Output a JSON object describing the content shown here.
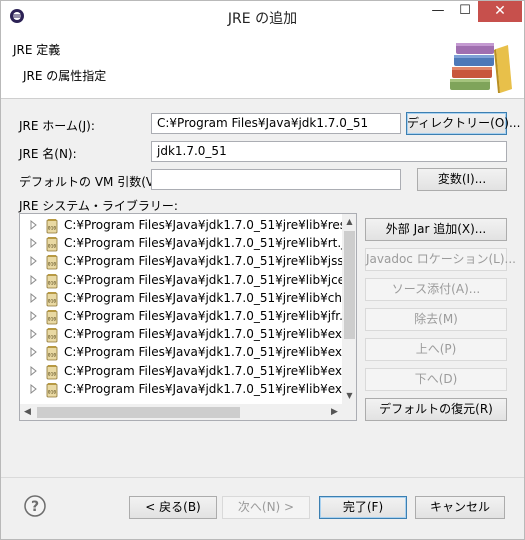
{
  "window": {
    "title": "JRE の追加",
    "close_glyph": "✕",
    "minimize_glyph": "—",
    "maximize_glyph": "☐"
  },
  "header": {
    "title": "JRE 定義",
    "description": "JRE の属性指定"
  },
  "form": {
    "jre_home_label": "JRE ホーム(J):",
    "jre_home_value": "C:¥Program Files¥Java¥jdk1.7.0_51",
    "directory_button": "ディレクトリー(O)...",
    "jre_name_label": "JRE 名(N):",
    "jre_name_value": "jdk1.7.0_51",
    "vm_args_label": "デフォルトの VM 引数(V):",
    "vm_args_value": "",
    "variables_button": "変数(I)...",
    "libraries_label": "JRE システム・ライブラリー:"
  },
  "libraries": [
    "C:¥Program Files¥Java¥jdk1.7.0_51¥jre¥lib¥res",
    "C:¥Program Files¥Java¥jdk1.7.0_51¥jre¥lib¥rt.j",
    "C:¥Program Files¥Java¥jdk1.7.0_51¥jre¥lib¥jsse",
    "C:¥Program Files¥Java¥jdk1.7.0_51¥jre¥lib¥jce",
    "C:¥Program Files¥Java¥jdk1.7.0_51¥jre¥lib¥cha",
    "C:¥Program Files¥Java¥jdk1.7.0_51¥jre¥lib¥jfr.j",
    "C:¥Program Files¥Java¥jdk1.7.0_51¥jre¥lib¥ext",
    "C:¥Program Files¥Java¥jdk1.7.0_51¥jre¥lib¥ext",
    "C:¥Program Files¥Java¥jdk1.7.0_51¥jre¥lib¥ext",
    "C:¥Program Files¥Java¥jdk1.7.0_51¥jre¥lib¥ext"
  ],
  "library_buttons": {
    "add_external_jar": "外部 Jar 追加(X)...",
    "javadoc_location": "Javadoc ロケーション(L)...",
    "source_attachment": "ソース添付(A)...",
    "remove": "除去(M)",
    "up": "上へ(P)",
    "down": "下へ(D)",
    "restore_default": "デフォルトの復元(R)"
  },
  "footer": {
    "back": "< 戻る(B)",
    "next": "次へ(N) >",
    "finish": "完了(F)",
    "cancel": "キャンセル"
  },
  "icons": {
    "app": "eclipse-icon",
    "header": "library-books-icon",
    "jar": "jar-icon",
    "help": "help-icon"
  },
  "colors": {
    "close_button": "#c7504c",
    "focus_border": "#3c7fb1"
  }
}
